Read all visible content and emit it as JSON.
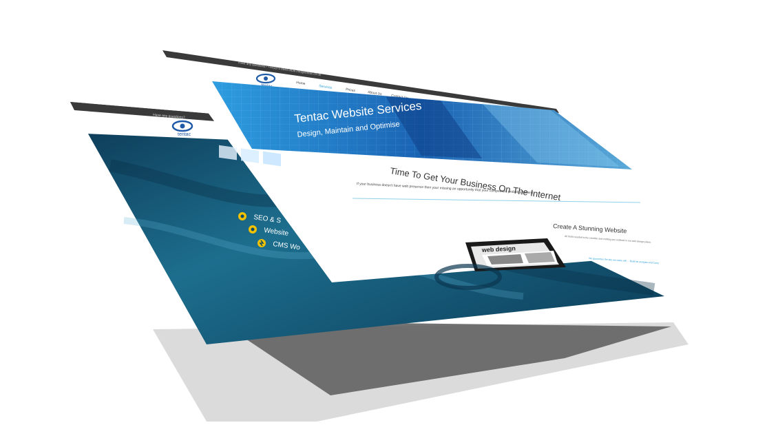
{
  "back_page": {
    "topbar_text": "Have any questions?",
    "logo_text": "tentac",
    "services": [
      {
        "label": "SEO & S"
      },
      {
        "label": "Website"
      },
      {
        "label": "CMS Wo"
      }
    ]
  },
  "front_page": {
    "topbar_text": "Have any questions?  +44(0)75 8648 0836  info@tentac.co.uk",
    "logo_text": "tentac",
    "nav": [
      "Home",
      "Services",
      "Prices",
      "About Us",
      "Contact Us"
    ],
    "hero_title": "Tentac Website Services",
    "hero_subtitle": "Design, Maintain and Optimise",
    "section_title": "Time To Get Your Business On The Internet",
    "section_text": "If your business doesn't have web presence then your missing an opportunity that your competitors probably haven't.",
    "feature_title": "Create A Stunning Website",
    "feature_text": "All that's needed is the creative and crafting you outlined in our web design plans.",
    "feature_link": "We guarantee the site we make will ... Build as analysis and Carry",
    "image_label": "web design"
  },
  "colors": {
    "topbar": "#3a3a3a",
    "back_bg": "#0f4a66",
    "hero_blue": "#1b6fb5",
    "accent_yellow": "#f2c200",
    "divider": "#8fd0e8"
  }
}
